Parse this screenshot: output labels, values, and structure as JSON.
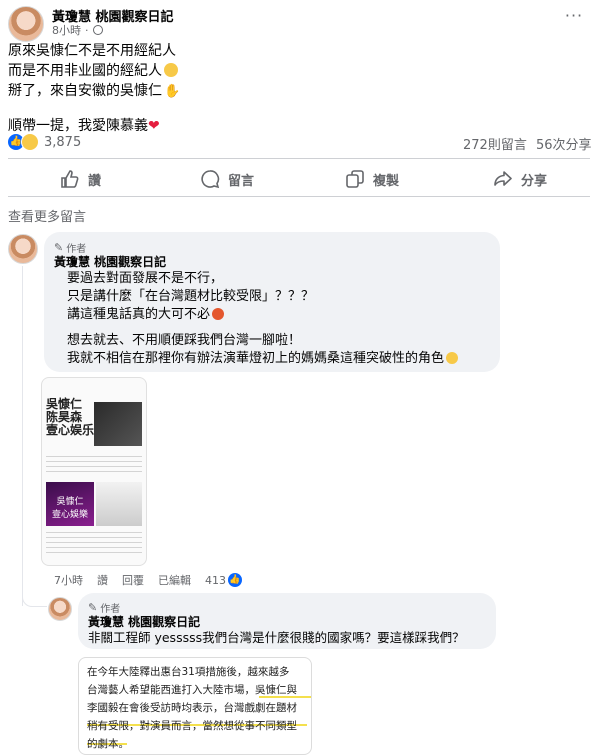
{
  "post": {
    "author": "黃瓊慧 桃園觀察日記",
    "time": "8小時",
    "lines": [
      "原來吳慷仁不是不用經紀人",
      "而是不用非业國的經紀人",
      "掰了，來自安徽的吳慷仁",
      "順帶一提，我愛陳慕義"
    ],
    "reaction_count": "3,875",
    "comments_count": "272則留言",
    "shares_count": "56次分享"
  },
  "actions": {
    "like": "讚",
    "comment": "留言",
    "copy": "複製",
    "share": "分享"
  },
  "more_comments": "查看更多留言",
  "comment1": {
    "badge": "作者",
    "author": "黃瓊慧 桃園觀察日記",
    "lines": [
      "要過去對面發展不是不行，",
      "只是講什麼「在台灣題材比較受限」？？？",
      "講這種鬼話真的大可不必",
      "想去就去、不用順便踩我們台灣一腳啦！",
      "我就不相信在那裡你有辦法演華燈初上的媽媽桑這種突破性的角色"
    ],
    "screenshot": {
      "title_1": "吳慷仁",
      "title_2": "陈昊森",
      "title_3": "壹心娱乐",
      "overlay_1": "吳慷仁",
      "overlay_2": "壹心娛樂"
    },
    "time": "7小時",
    "like": "讚",
    "reply": "回覆",
    "edited": "已編輯",
    "reactions": "413"
  },
  "comment2": {
    "badge": "作者",
    "author": "黃瓊慧 桃園觀察日記",
    "text": "非關工程師 yesssss我們台灣是什麼很賤的國家嗎？要這樣踩我們？",
    "quote_lines": [
      "在今年大陸釋出惠台31項措施後，越來越多",
      "台灣藝人希望能西進打入大陸市場，吳慷仁與",
      "李國毅在會後受訪時均表示，台灣戲劇在題材",
      "稍有受限，對演員而言，當然想從事不同類型",
      "的劇本。"
    ]
  },
  "colors": {
    "accent": "#0866ff",
    "secondary_text": "#65676b",
    "bubble": "#f0f2f5"
  }
}
